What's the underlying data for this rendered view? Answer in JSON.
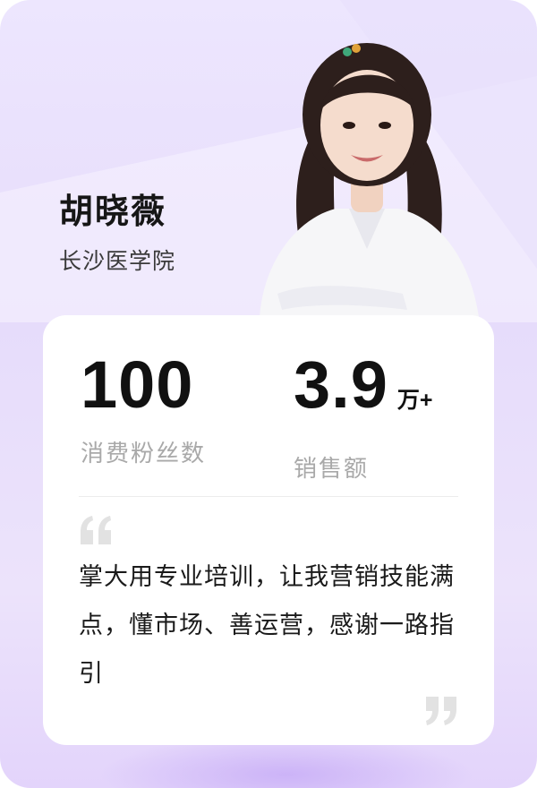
{
  "profile": {
    "name": "胡晓薇",
    "school": "长沙医学院"
  },
  "stats": [
    {
      "value": "100",
      "unit": "",
      "label": "消费粉丝数"
    },
    {
      "value": "3.9",
      "unit": "万+",
      "label": "销售额"
    }
  ],
  "testimonial": {
    "text": "掌大用专业培训，让我营销技能满点，懂市场、善运营，感谢一路指引"
  },
  "colors": {
    "background": "#ece5fd",
    "panel": "#ffffff",
    "label_gray": "#a9a9a9",
    "quote_gray": "#e2e2e2"
  }
}
